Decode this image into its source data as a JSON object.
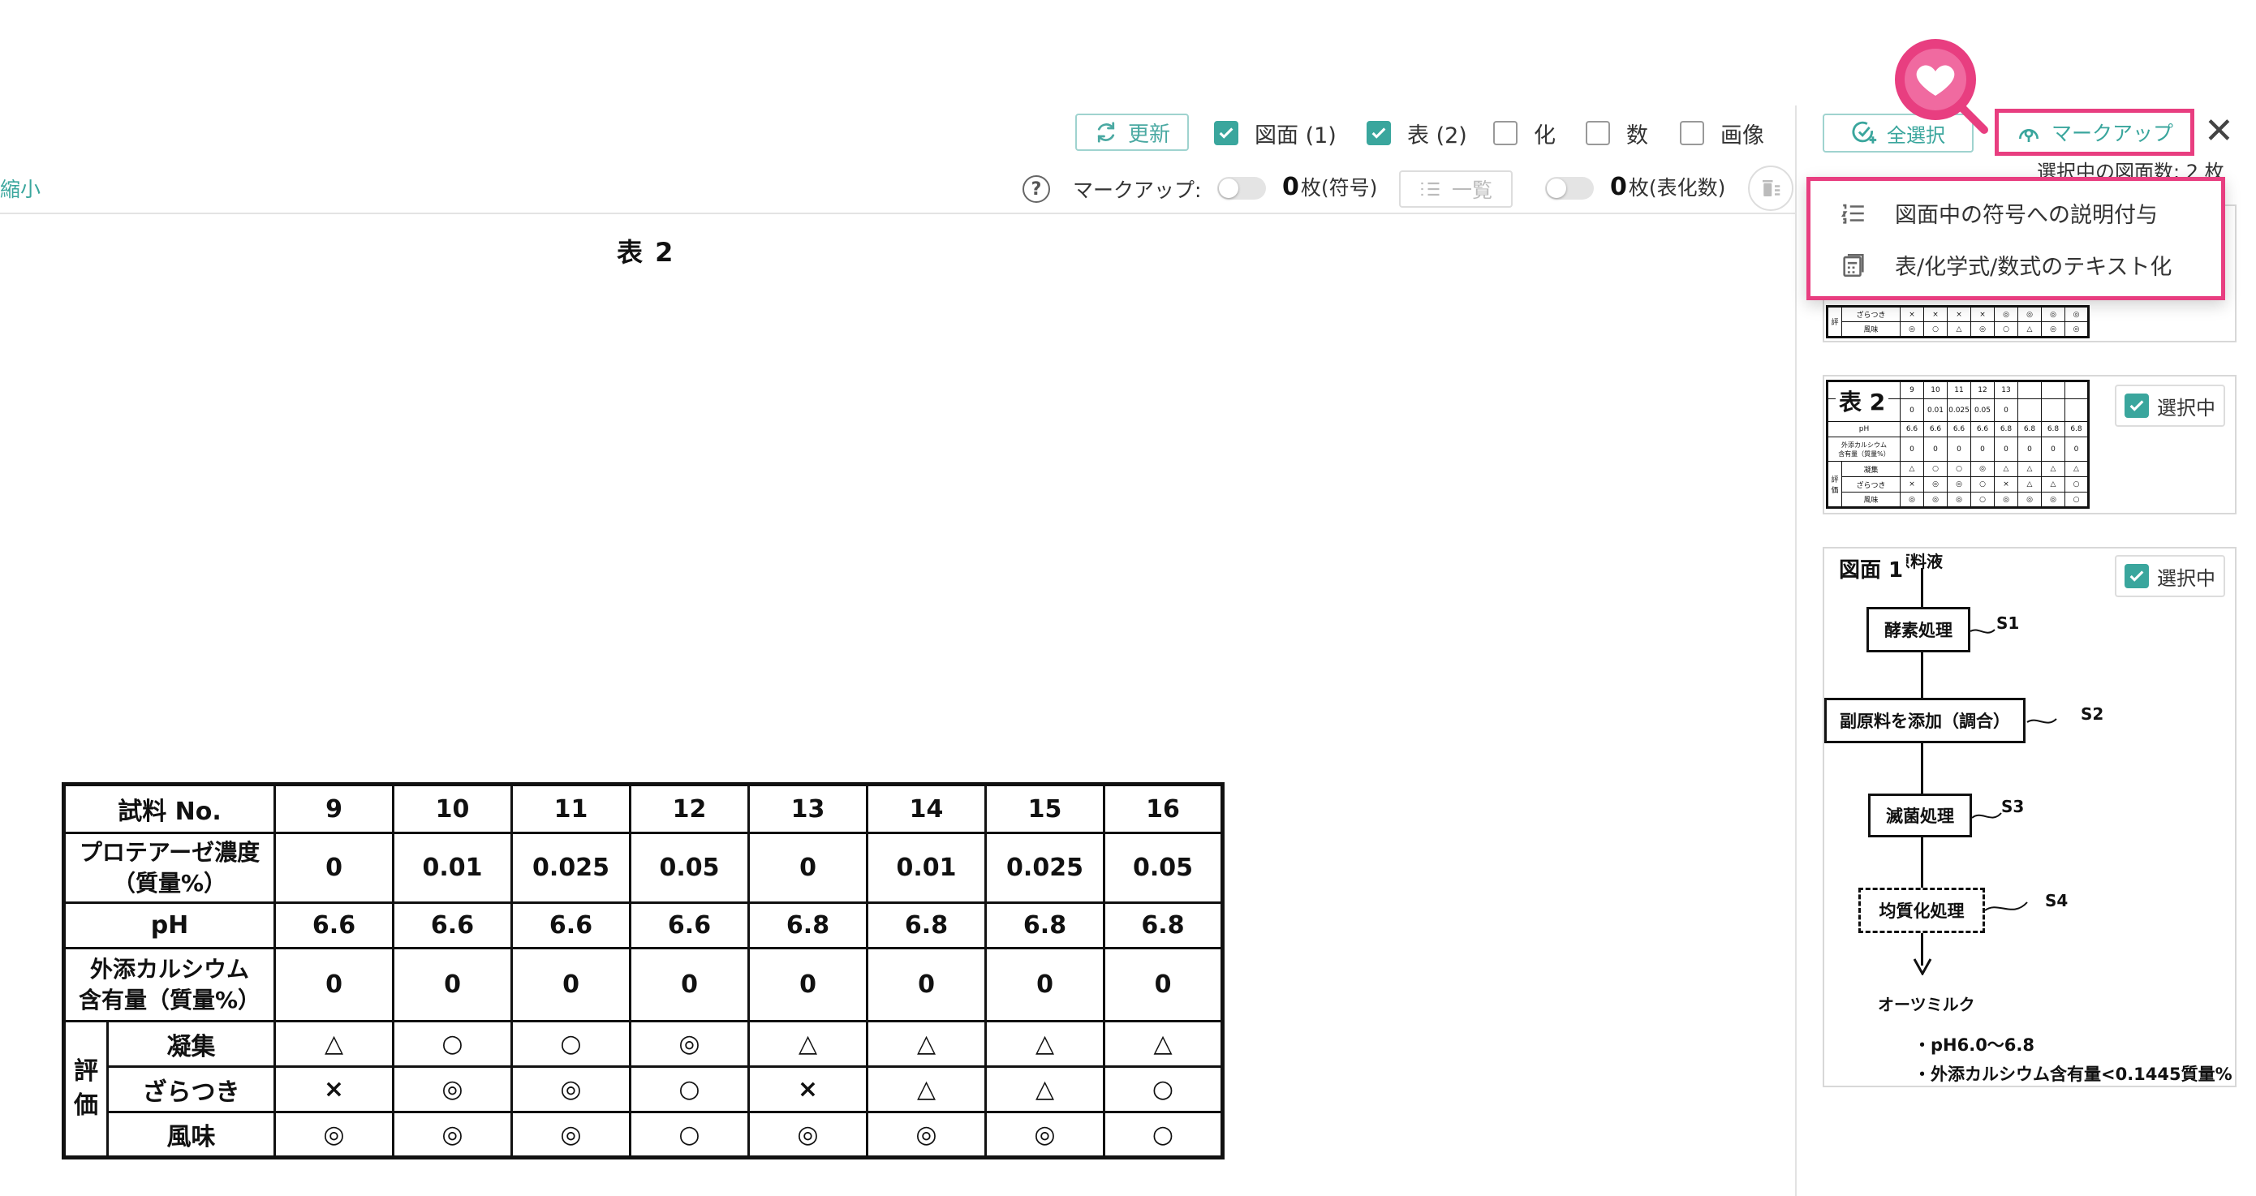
{
  "toolbar": {
    "refresh_label": "更新",
    "filters": [
      {
        "label": "図面 (1)",
        "checked": true
      },
      {
        "label": "表 (2)",
        "checked": true
      },
      {
        "label": "化",
        "checked": false
      },
      {
        "label": "数",
        "checked": false
      },
      {
        "label": "画像",
        "checked": false
      }
    ],
    "shrink_label": "縮小",
    "help_glyph": "?",
    "markup_label": "マークアップ:",
    "symbol_count_num": "0",
    "symbol_count_unit": "枚(符号)",
    "list_label": "一覧",
    "table_count_num": "0",
    "table_count_unit": "枚(表化数)"
  },
  "main": {
    "title": "表 2",
    "table": {
      "row_header": "試料 No.",
      "sample_numbers": [
        "9",
        "10",
        "11",
        "12",
        "13",
        "14",
        "15",
        "16"
      ],
      "rows": [
        {
          "label": "プロテアーゼ濃度\n（質量%）",
          "values": [
            "0",
            "0.01",
            "0.025",
            "0.05",
            "0",
            "0.01",
            "0.025",
            "0.05"
          ]
        },
        {
          "label": "pH",
          "values": [
            "6.6",
            "6.6",
            "6.6",
            "6.6",
            "6.8",
            "6.8",
            "6.8",
            "6.8"
          ]
        },
        {
          "label": "外添カルシウム\n含有量（質量%）",
          "values": [
            "0",
            "0",
            "0",
            "0",
            "0",
            "0",
            "0",
            "0"
          ]
        }
      ],
      "eval_group_label": "評\n価",
      "eval_rows": [
        {
          "label": "凝集",
          "values": [
            "△",
            "○",
            "○",
            "◎",
            "△",
            "△",
            "△",
            "△"
          ]
        },
        {
          "label": "ざらつき",
          "values": [
            "×",
            "◎",
            "◎",
            "○",
            "×",
            "△",
            "△",
            "○"
          ]
        },
        {
          "label": "風味",
          "values": [
            "◎",
            "◎",
            "◎",
            "○",
            "◎",
            "◎",
            "◎",
            "○"
          ]
        }
      ]
    }
  },
  "panel": {
    "select_all_label": "全選択",
    "markup_button_label": "マークアップ",
    "close_glyph": "✕",
    "selected_count_text": "選択中の図面数: 2 枚",
    "dropdown": [
      {
        "label": "図面中の符号への説明付与"
      },
      {
        "label": "表/化学式/数式のテキスト化"
      }
    ],
    "thumb_top": {
      "eval_rows": [
        {
          "label": "ざらつき",
          "values": [
            "×",
            "×",
            "×",
            "×",
            "◎",
            "◎",
            "◎",
            "◎"
          ]
        },
        {
          "label": "風味",
          "values": [
            "◎",
            "○",
            "△",
            "◎",
            "○",
            "△",
            "◎",
            "◎"
          ]
        }
      ]
    },
    "thumb_table2": {
      "label": "表 2",
      "selected_label": "選択中",
      "numbers": [
        "9",
        "10",
        "11",
        "12",
        "13"
      ],
      "conc": [
        "0",
        "0.01",
        "0.025",
        "0.05",
        "0"
      ],
      "ph_label": "pH",
      "ph": [
        "6.6",
        "6.6",
        "6.6",
        "6.6",
        "6.8",
        "6.8",
        "6.8",
        "6.8"
      ],
      "ca_label": "外添カルシウム\n含有量（質量%）",
      "ca": [
        "0",
        "0",
        "0",
        "0",
        "0",
        "0",
        "0",
        "0"
      ],
      "group_label": "評\n価",
      "eval_rows": [
        {
          "label": "凝集",
          "values": [
            "△",
            "○",
            "○",
            "◎",
            "△",
            "△",
            "△",
            "△"
          ]
        },
        {
          "label": "ざらつき",
          "values": [
            "×",
            "◎",
            "◎",
            "○",
            "×",
            "△",
            "△",
            "○"
          ]
        },
        {
          "label": "風味",
          "values": [
            "◎",
            "◎",
            "◎",
            "○",
            "◎",
            "◎",
            "◎",
            "○"
          ]
        }
      ]
    },
    "thumb_figure1": {
      "label": "図面 1",
      "selected_label": "選択中",
      "top_text": "原料液",
      "steps": [
        {
          "label": "酵素処理",
          "code": "S1"
        },
        {
          "label": "副原料を添加（調合）",
          "code": "S2"
        },
        {
          "label": "滅菌処理",
          "code": "S3"
        },
        {
          "label": "均質化処理",
          "code": "S4"
        }
      ],
      "product": "オーツミルク",
      "notes": [
        "・pH6.0〜6.8",
        "・外添カルシウム含有量<0.1445質量%"
      ]
    }
  },
  "colors": {
    "accent": "#3aa69d",
    "highlight": "#e83e80"
  }
}
